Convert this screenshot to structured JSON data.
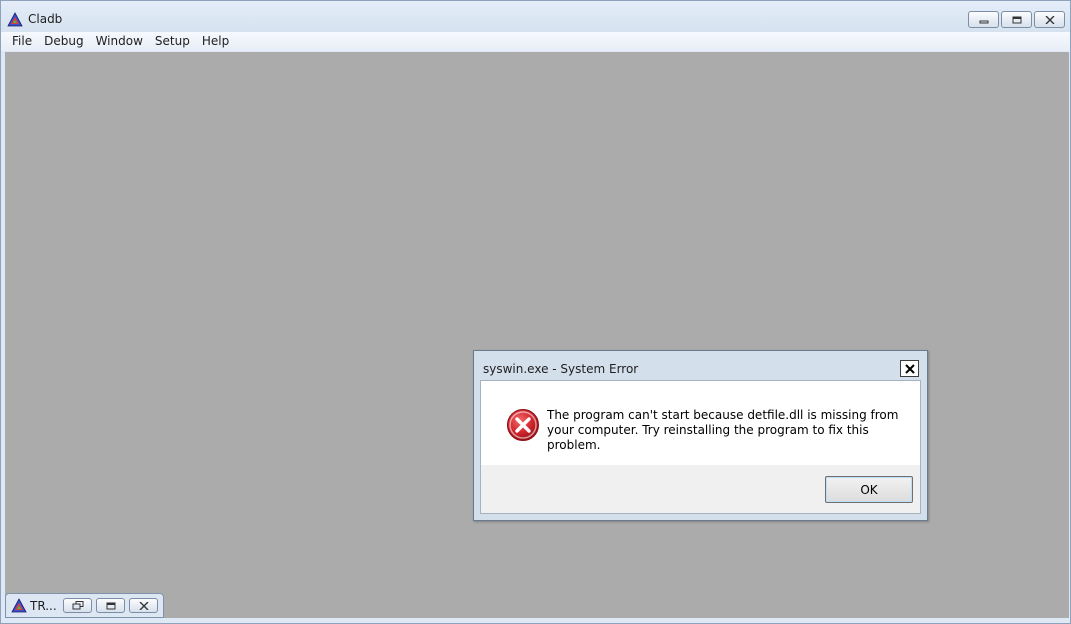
{
  "app": {
    "title": "Cladb",
    "icon": "triangle-app-icon",
    "caption_buttons": [
      "minimize",
      "restore",
      "close"
    ]
  },
  "menu": {
    "items": [
      {
        "label": "File"
      },
      {
        "label": "Debug"
      },
      {
        "label": "Window"
      },
      {
        "label": "Setup"
      },
      {
        "label": "Help"
      }
    ]
  },
  "minimized_child": {
    "title": "TR...",
    "icon": "triangle-app-icon",
    "buttons": [
      "restore",
      "maximize",
      "close"
    ]
  },
  "dialog": {
    "title": "syswin.exe - System Error",
    "icon": "error-icon",
    "message": "The program can't start because detfile.dll is missing from your computer. Try reinstalling the program to fix this problem.",
    "ok_label": "OK"
  },
  "colors": {
    "mdi_background": "#ababab",
    "error_red": "#c8232c"
  }
}
